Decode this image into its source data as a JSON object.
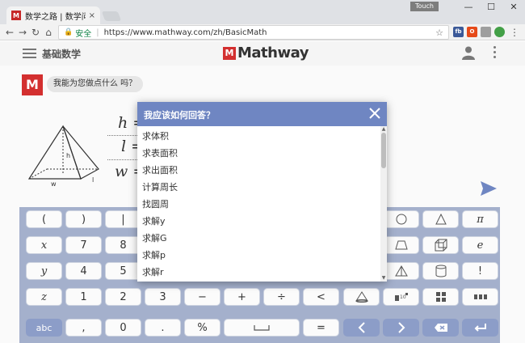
{
  "browser": {
    "tab_title": "数学之路 | 数学问题的解",
    "tab_favicon": "M",
    "tab_close": "×",
    "touch_label": "Touch",
    "minimize": "—",
    "maximize": "☐",
    "close": "✕",
    "secure_label": "安全",
    "url": "https://www.mathway.com/zh/BasicMath",
    "ext_labels": [
      "fb",
      "O",
      "",
      ""
    ]
  },
  "app": {
    "header_title": "基础数学",
    "logo_text": "Mathway",
    "logo_mark": "M",
    "bot_avatar": "M",
    "bot_message": "我能为您做点什么 吗？"
  },
  "problem": {
    "equations": [
      {
        "var": "h",
        "op": "="
      },
      {
        "var": "l",
        "op": "="
      },
      {
        "var": "w",
        "op": "="
      }
    ],
    "figure_labels": {
      "h": "h",
      "w": "w",
      "l": "l"
    }
  },
  "dialog": {
    "title": "我应该如何回答？",
    "options": [
      "求体积",
      "求表面积",
      "求出面积",
      "计算周长",
      "找圆周",
      "求解y",
      "求解G",
      "求解p",
      "求解r"
    ]
  },
  "keyboard": {
    "rows": [
      [
        "(",
        ")",
        "|",
        "",
        "",
        "",
        "",
        "",
        "",
        "circle",
        "triangle",
        "π"
      ],
      [
        "x",
        "7",
        "8",
        "",
        "",
        "",
        "",
        "",
        "",
        "trapezoid",
        "cube",
        "e"
      ],
      [
        "y",
        "4",
        "5",
        "",
        "",
        "",
        "",
        "",
        "",
        "pyramid",
        "cylinder",
        "!"
      ],
      [
        "z",
        "1",
        "2",
        "3",
        "−",
        "+",
        "÷",
        "<",
        "cone",
        "sci-notation",
        "matrix",
        "more"
      ],
      [
        "abc",
        ",",
        "0",
        ".",
        "%",
        "space",
        "=",
        "left",
        "right",
        "backspace",
        "enter"
      ]
    ]
  },
  "colors": {
    "brand_red": "#d32f2f",
    "dialog_header": "#6f86c2",
    "keyboard_bg": "#a4b0cc",
    "key_blue": "#8c9dc8"
  }
}
